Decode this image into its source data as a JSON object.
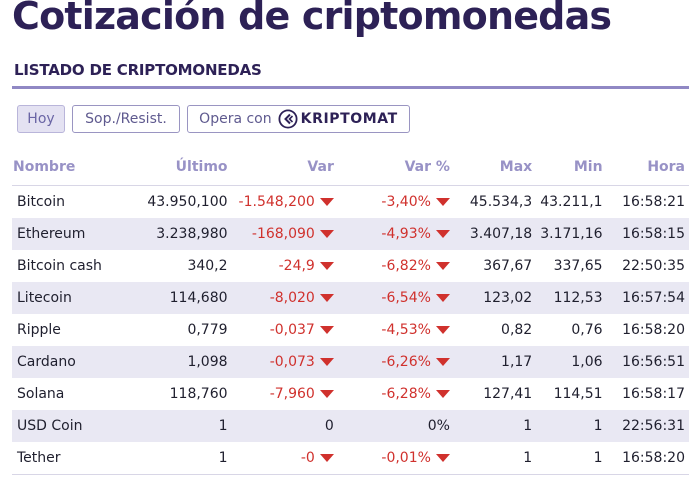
{
  "page": {
    "title": "Cotización de criptomonedas",
    "section_title": "LISTADO DE CRIPTOMONEDAS"
  },
  "tabs": [
    {
      "label": "Hoy",
      "active": true
    },
    {
      "label": "Sop./Resist.",
      "active": false
    },
    {
      "label": "Opera con",
      "partner": "KRIPTOMAT",
      "active": false
    }
  ],
  "colors": {
    "brand": "#2d2156",
    "accent": "#9088c4",
    "negative": "#d0312d"
  },
  "table": {
    "headers": [
      "Nombre",
      "Último",
      "Var",
      "Var %",
      "Max",
      "Min",
      "Hora"
    ],
    "rows": [
      {
        "name": "Bitcoin",
        "last": "43.950,100",
        "var": "-1.548,200",
        "var_pct": "-3,40%",
        "max": "45.534,3",
        "min": "43.211,1",
        "time": "16:58:21",
        "trend": "down"
      },
      {
        "name": "Ethereum",
        "last": "3.238,980",
        "var": "-168,090",
        "var_pct": "-4,93%",
        "max": "3.407,18",
        "min": "3.171,16",
        "time": "16:58:15",
        "trend": "down"
      },
      {
        "name": "Bitcoin cash",
        "last": "340,2",
        "var": "-24,9",
        "var_pct": "-6,82%",
        "max": "367,67",
        "min": "337,65",
        "time": "22:50:35",
        "trend": "down"
      },
      {
        "name": "Litecoin",
        "last": "114,680",
        "var": "-8,020",
        "var_pct": "-6,54%",
        "max": "123,02",
        "min": "112,53",
        "time": "16:57:54",
        "trend": "down"
      },
      {
        "name": "Ripple",
        "last": "0,779",
        "var": "-0,037",
        "var_pct": "-4,53%",
        "max": "0,82",
        "min": "0,76",
        "time": "16:58:20",
        "trend": "down"
      },
      {
        "name": "Cardano",
        "last": "1,098",
        "var": "-0,073",
        "var_pct": "-6,26%",
        "max": "1,17",
        "min": "1,06",
        "time": "16:56:51",
        "trend": "down"
      },
      {
        "name": "Solana",
        "last": "118,760",
        "var": "-7,960",
        "var_pct": "-6,28%",
        "max": "127,41",
        "min": "114,51",
        "time": "16:58:17",
        "trend": "down"
      },
      {
        "name": "USD Coin",
        "last": "1",
        "var": "0",
        "var_pct": "0%",
        "max": "1",
        "min": "1",
        "time": "22:56:31",
        "trend": "flat"
      },
      {
        "name": "Tether",
        "last": "1",
        "var": "-0",
        "var_pct": "-0,01%",
        "max": "1",
        "min": "1",
        "time": "16:58:20",
        "trend": "down"
      }
    ]
  }
}
